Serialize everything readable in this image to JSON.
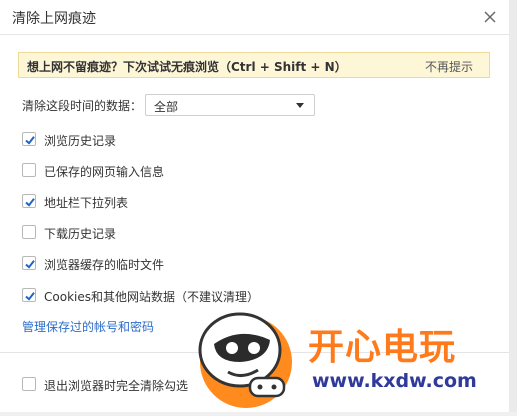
{
  "window": {
    "title": "清除上网痕迹"
  },
  "banner": {
    "text": "想上网不留痕迹？下次试试无痕浏览（Ctrl + Shift + N）",
    "dismiss_label": "不再提示"
  },
  "range": {
    "label": "清除这段时间的数据：",
    "selected": "全部"
  },
  "options": [
    {
      "label": "浏览历史记录",
      "checked": true
    },
    {
      "label": "已保存的网页输入信息",
      "checked": false
    },
    {
      "label": "地址栏下拉列表",
      "checked": true
    },
    {
      "label": "下载历史记录",
      "checked": false
    },
    {
      "label": "浏览器缓存的临时文件",
      "checked": true
    },
    {
      "label": "Cookies和其他网站数据（不建议清理）",
      "checked": true
    }
  ],
  "manage_link": "管理保存过的帐号和密码",
  "exit_option": {
    "label": "退出浏览器时完全清除勾选",
    "checked": false
  },
  "watermark": {
    "brand": "开心电玩",
    "url": "www.kxdw.com"
  },
  "colors": {
    "accent": "#1e64c8",
    "banner_bg": "#fdf7d8",
    "link": "#2a6cc8",
    "watermark_orange": "#ff7a1a",
    "watermark_blue": "#2f3a9a"
  }
}
